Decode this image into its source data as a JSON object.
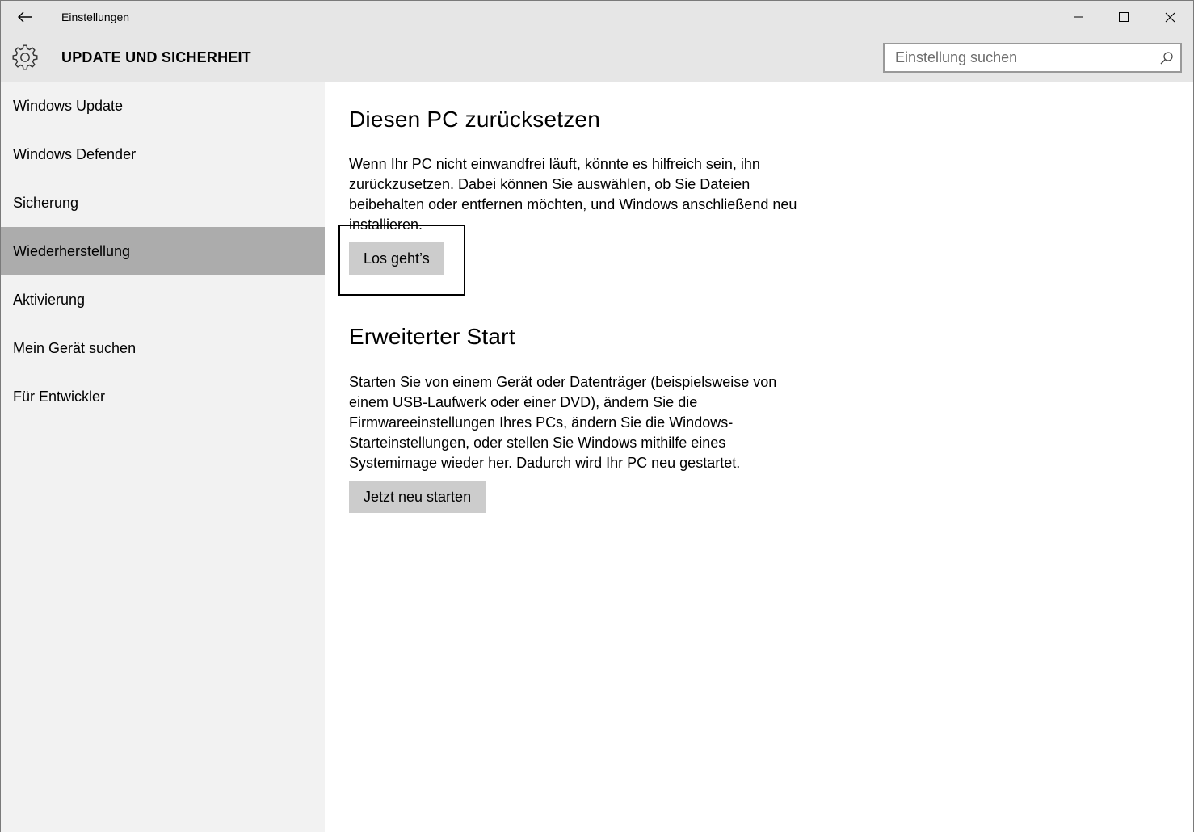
{
  "window": {
    "title": "Einstellungen",
    "controls": [
      "minimize-icon",
      "maximize-icon",
      "close-icon"
    ]
  },
  "header": {
    "section_title": "UPDATE UND SICHERHEIT",
    "search_placeholder": "Einstellung suchen",
    "search_value": ""
  },
  "sidebar": {
    "items": [
      {
        "label": "Windows Update",
        "active": false
      },
      {
        "label": "Windows Defender",
        "active": false
      },
      {
        "label": "Sicherung",
        "active": false
      },
      {
        "label": "Wiederherstellung",
        "active": true
      },
      {
        "label": "Aktivierung",
        "active": false
      },
      {
        "label": "Mein Gerät suchen",
        "active": false
      },
      {
        "label": "Für Entwickler",
        "active": false
      }
    ]
  },
  "main": {
    "reset": {
      "heading": "Diesen PC zurücksetzen",
      "description": "Wenn Ihr PC nicht einwandfrei läuft, könnte es hilfreich sein, ihn zurückzusetzen. Dabei können Sie auswählen, ob Sie Dateien beibehalten oder entfernen möchten, und Windows anschließend neu installieren.",
      "button_label": "Los geht’s"
    },
    "advanced": {
      "heading": "Erweiterter Start",
      "description": "Starten Sie von einem Gerät oder Datenträger (beispielsweise von einem USB-Laufwerk oder einer DVD), ändern Sie die Firmwareeinstellungen Ihres PCs, ändern Sie die Windows-Starteinstellungen, oder stellen Sie Windows mithilfe eines Systemimage wieder her. Dadurch wird Ihr PC neu gestartet.",
      "button_label": "Jetzt neu starten"
    }
  },
  "colors": {
    "chrome": "#e6e6e6",
    "sidebar": "#f2f2f2",
    "active_item": "#acacac",
    "button": "#cccccc"
  }
}
